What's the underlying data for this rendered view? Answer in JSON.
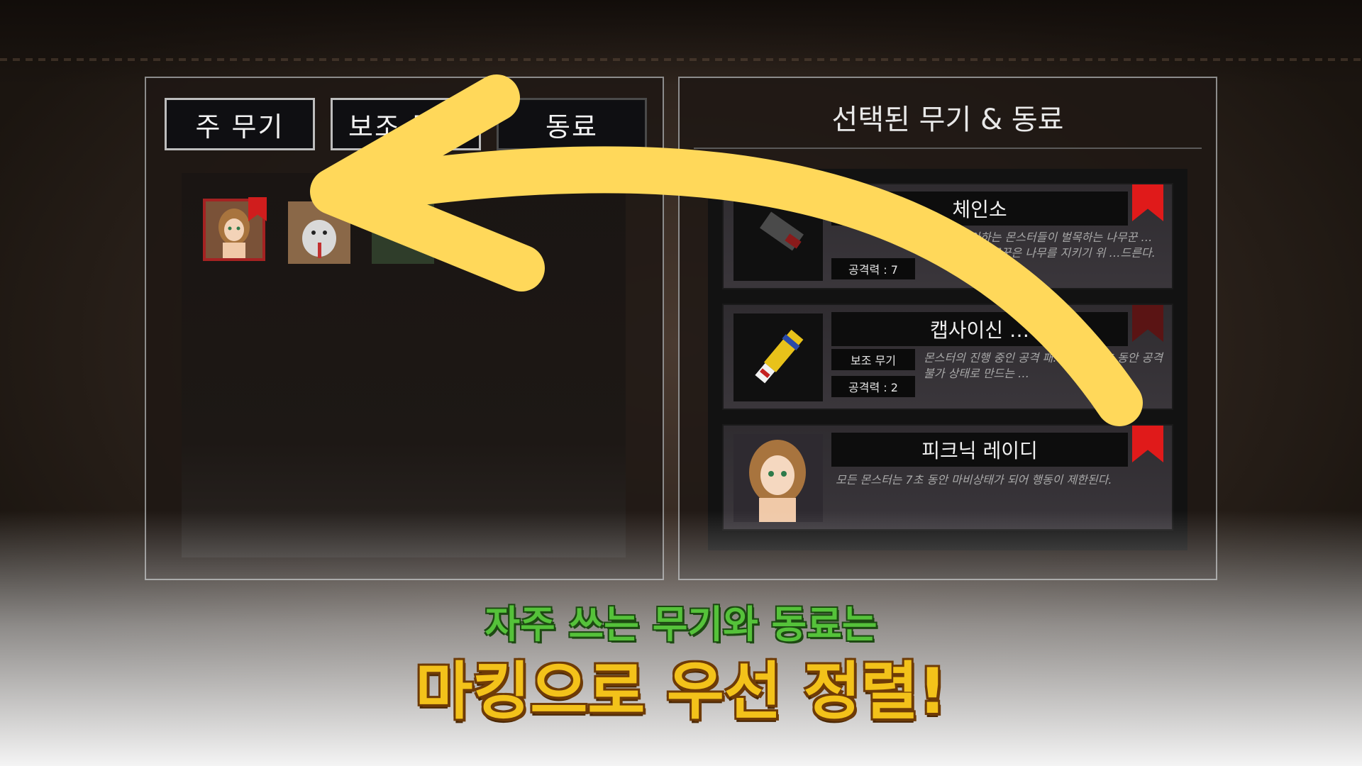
{
  "tabs": {
    "main": "주 무기",
    "sub": "보조 무기",
    "companion": "동료"
  },
  "selected_panel": {
    "title": "선택된 무기 & 동료",
    "items": [
      {
        "name": "체인소",
        "badge_stat": "공격력 : 7",
        "desc": "…치기 좋아하는 몬스터들이 벌목하는 나무꾼 …다. 화가 난 나무꾼은 나무를 지키기 위 …드른다."
      },
      {
        "name": "캡사이신 …",
        "badge_type": "보조 무기",
        "badge_stat": "공격력 : 2",
        "desc": "몬스터의 진행 중인 공격 패… 하고, 5초 동안 공격 불가 상태로 만드는 …"
      },
      {
        "name": "피크닉 레이디",
        "desc": "모든 몬스터는 7초 동안 마비상태가 되어 행동이 제한된다."
      }
    ]
  },
  "caption": {
    "line1": "자주 쓰는 무기와 동료는",
    "line2": "마킹으로 우선 정렬!"
  },
  "colors": {
    "mark": "#d01d1d",
    "arrow": "#ffd85a",
    "caption_green": "#55c23a",
    "caption_gold": "#f3c21a"
  }
}
